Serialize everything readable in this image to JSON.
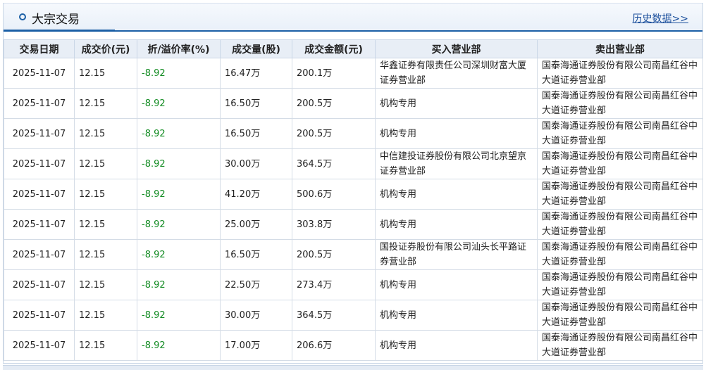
{
  "header": {
    "title": "大宗交易",
    "history_link": "历史数据>>"
  },
  "columns": [
    "交易日期",
    "成交价(元)",
    "折/溢价率(%)",
    "成交量(股)",
    "成交金额(元)",
    "买入营业部",
    "卖出营业部"
  ],
  "rows": [
    [
      "2025-11-07",
      "12.15",
      "-8.92",
      "16.47万",
      "200.1万",
      "华鑫证券有限责任公司深圳财富大厦证券营业部",
      "国泰海通证券股份有限公司南昌红谷中大道证券营业部"
    ],
    [
      "2025-11-07",
      "12.15",
      "-8.92",
      "16.50万",
      "200.5万",
      "机构专用",
      "国泰海通证券股份有限公司南昌红谷中大道证券营业部"
    ],
    [
      "2025-11-07",
      "12.15",
      "-8.92",
      "16.50万",
      "200.5万",
      "机构专用",
      "国泰海通证券股份有限公司南昌红谷中大道证券营业部"
    ],
    [
      "2025-11-07",
      "12.15",
      "-8.92",
      "30.00万",
      "364.5万",
      "中信建投证券股份有限公司北京望京证券营业部",
      "国泰海通证券股份有限公司南昌红谷中大道证券营业部"
    ],
    [
      "2025-11-07",
      "12.15",
      "-8.92",
      "41.20万",
      "500.6万",
      "机构专用",
      "国泰海通证券股份有限公司南昌红谷中大道证券营业部"
    ],
    [
      "2025-11-07",
      "12.15",
      "-8.92",
      "25.00万",
      "303.8万",
      "机构专用",
      "国泰海通证券股份有限公司南昌红谷中大道证券营业部"
    ],
    [
      "2025-11-07",
      "12.15",
      "-8.92",
      "16.50万",
      "200.5万",
      "国投证券股份有限公司汕头长平路证券营业部",
      "国泰海通证券股份有限公司南昌红谷中大道证券营业部"
    ],
    [
      "2025-11-07",
      "12.15",
      "-8.92",
      "22.50万",
      "273.4万",
      "机构专用",
      "国泰海通证券股份有限公司南昌红谷中大道证券营业部"
    ],
    [
      "2025-11-07",
      "12.15",
      "-8.92",
      "30.00万",
      "364.5万",
      "机构专用",
      "国泰海通证券股份有限公司南昌红谷中大道证券营业部"
    ],
    [
      "2025-11-07",
      "12.15",
      "-8.92",
      "17.00万",
      "206.6万",
      "机构专用",
      "国泰海通证券股份有限公司南昌红谷中大道证券营业部"
    ]
  ],
  "colors": {
    "accent": "#1b5fa6",
    "negative": "#128b22",
    "header_bg": "#e8eef6"
  },
  "icons": {
    "title_marker": "circle-icon"
  }
}
